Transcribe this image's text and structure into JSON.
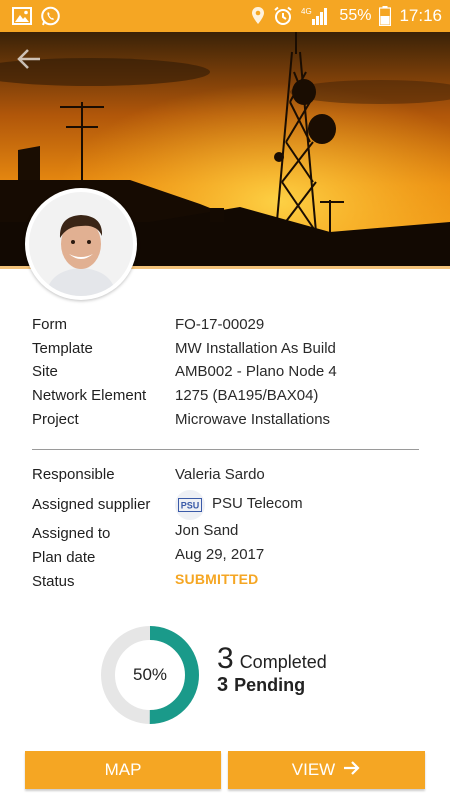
{
  "status_bar": {
    "battery": "55%",
    "time": "17:16",
    "network": "4G",
    "icons": [
      "image-icon",
      "whatsapp-icon",
      "location-icon",
      "alarm-icon",
      "signal-icon",
      "battery-icon"
    ]
  },
  "header": {
    "back_icon": "arrow-left-icon",
    "hero_image": "telecom-tower-sunset"
  },
  "form_details": [
    {
      "label": "Form",
      "value": "FO-17-00029"
    },
    {
      "label": "Template",
      "value": "MW Installation As Build"
    },
    {
      "label": "Site",
      "value": "AMB002 - Plano Node 4"
    },
    {
      "label": "Network Element",
      "value": "1275 (BA195/BAX04)"
    },
    {
      "label": "Project",
      "value": "Microwave Installations"
    }
  ],
  "assignment": {
    "responsible_label": "Responsible",
    "responsible_value": "Valeria Sardo",
    "supplier_label": "Assigned supplier",
    "supplier_value": "PSU Telecom",
    "supplier_logo_text": "PSU",
    "assigned_to_label": "Assigned to",
    "assigned_to_value": "Jon Sand",
    "plan_date_label": "Plan date",
    "plan_date_value": "Aug 29, 2017",
    "status_label": "Status",
    "status_value": "SUBMITTED"
  },
  "progress": {
    "percent_label": "50%",
    "percent": 0.5,
    "completed_count": "3",
    "completed_label": "Completed",
    "pending_count": "3",
    "pending_label": "Pending"
  },
  "actions": {
    "map_label": "MAP",
    "view_label": "VIEW"
  },
  "colors": {
    "accent": "#f5a623",
    "progress": "#1a9a8a",
    "track": "#e6e6e6"
  }
}
